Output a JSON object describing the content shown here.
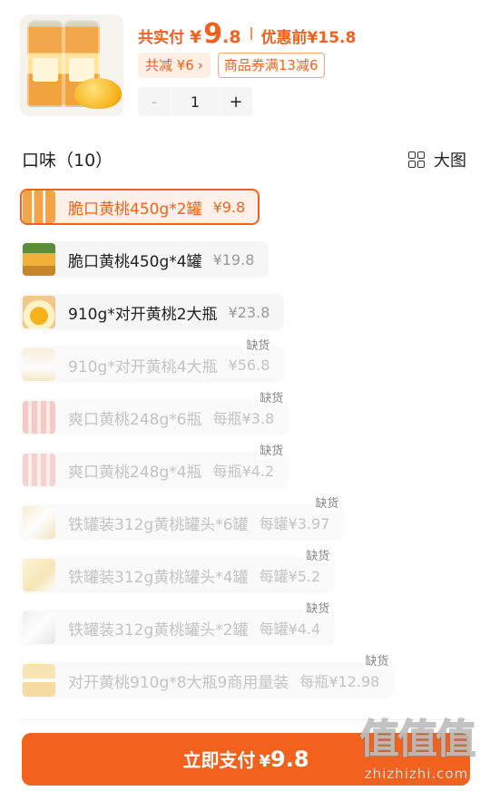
{
  "header": {
    "price_label": "共实付",
    "currency": "¥",
    "price_int": "9",
    "price_dec": ".8",
    "original_label": "优惠前¥15.8",
    "discount_label": "共减 ¥6",
    "discount_chevron": "›",
    "coupon_label": "商品券满13减6"
  },
  "stepper": {
    "minus": "-",
    "value": "1",
    "plus": "+"
  },
  "section": {
    "title": "口味（10）",
    "bigview_label": "大图",
    "bigview_icon": "grid-icon"
  },
  "options": [
    {
      "name": "脆口黄桃450g*2罐",
      "price": "¥9.8",
      "state": "selected"
    },
    {
      "name": "脆口黄桃450g*4罐",
      "price": "¥19.8",
      "state": "normal"
    },
    {
      "name": "910g*对开黄桃2大瓶",
      "price": "¥23.8",
      "state": "normal"
    },
    {
      "name": "910g*对开黄桃4大瓶",
      "price": "¥56.8",
      "state": "soldout",
      "tag": "缺货"
    },
    {
      "name": "爽口黄桃248g*6瓶",
      "price": "每瓶¥3.8",
      "state": "soldout",
      "tag": "缺货"
    },
    {
      "name": "爽口黄桃248g*4瓶",
      "price": "每瓶¥4.2",
      "state": "soldout",
      "tag": "缺货"
    },
    {
      "name": "铁罐装312g黄桃罐头*6罐",
      "price": "每罐¥3.97",
      "state": "soldout",
      "tag": "缺货"
    },
    {
      "name": "铁罐装312g黄桃罐头*4罐",
      "price": "每罐¥5.2",
      "state": "soldout",
      "tag": "缺货"
    },
    {
      "name": "铁罐装312g黄桃罐头*2罐",
      "price": "每罐¥4.4",
      "state": "soldout",
      "tag": "缺货"
    },
    {
      "name": "对开黄桃910g*8大瓶9商用量装",
      "price": "每瓶¥12.98",
      "state": "soldout",
      "tag": "缺货"
    }
  ],
  "footer": {
    "pay_label": "立即支付",
    "pay_currency": "¥",
    "pay_amount": "9.8"
  },
  "watermark": {
    "logo": "值值值",
    "url": "zhizhizhi.com"
  },
  "colors": {
    "accent": "#f2621d",
    "selected_bg": "#fff1ea",
    "chip_bg": "#ffefe5"
  }
}
